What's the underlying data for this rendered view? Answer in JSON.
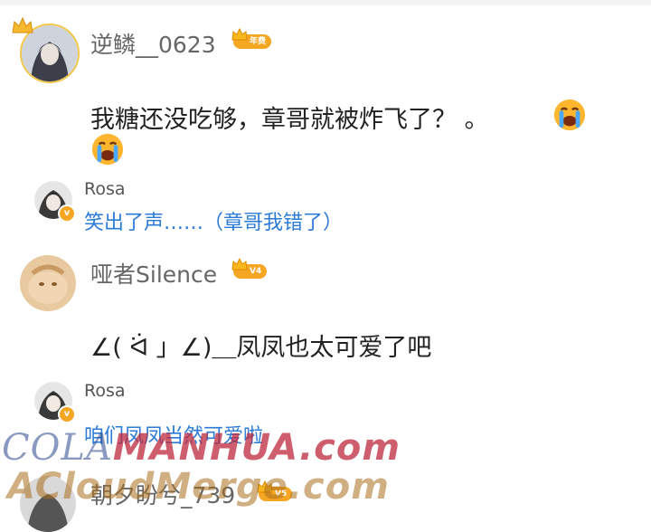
{
  "comments": [
    {
      "user": "逆鳞__0623",
      "badge": "年费",
      "text": "我糖还没吃够，章哥就被炸飞了？ 。",
      "emoji": "loudly-crying-face",
      "reply": {
        "user": "Rosa",
        "text": "笑出了声……（章哥我错了）"
      }
    },
    {
      "user": "哑者Silence",
      "badge": "V4",
      "text": "∠( ᐛ 」∠)＿凤凤也太可爱了吧",
      "reply": {
        "user": "Rosa",
        "text": "咱们凤凤当然可爱啦"
      }
    },
    {
      "user": "朝夕盼兮_739",
      "badge": "V5"
    }
  ],
  "watermark": {
    "line1_a": "COLA",
    "line1_b": "MANHUA.com",
    "line2": "ACloudMerge.com"
  },
  "colors": {
    "accent": "#f5a623",
    "link": "#2c7bd6"
  }
}
